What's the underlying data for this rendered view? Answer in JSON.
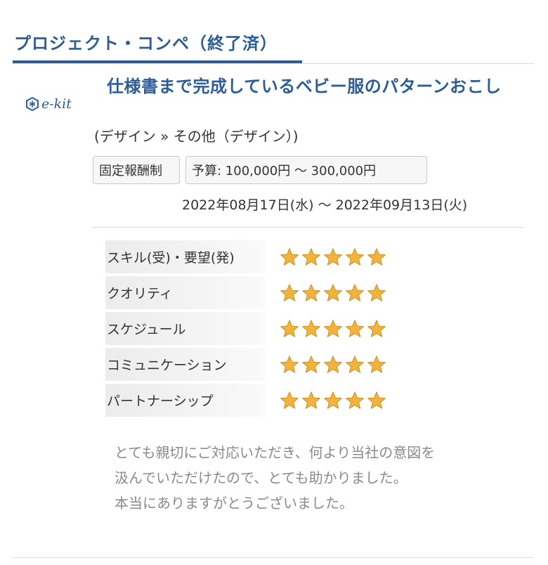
{
  "section": {
    "title": "プロジェクト・コンペ（終了済）",
    "accent_color": "#2e5d96"
  },
  "project": {
    "logo_text": "e-kit",
    "title": "仕様書まで完成しているベビー服のパターンおこし",
    "category": "(デザイン » その他（デザイン）)",
    "fee_type": "固定報酬制",
    "budget": "予算: 100,000円 〜 300,000円",
    "period": "2022年08月17日(水) 〜 2022年09月13日(火)"
  },
  "ratings": [
    {
      "label": "スキル(受)・要望(発)",
      "stars": 5,
      "max": 5
    },
    {
      "label": "クオリティ",
      "stars": 5,
      "max": 5
    },
    {
      "label": "スケジュール",
      "stars": 5,
      "max": 5
    },
    {
      "label": "コミュニケーション",
      "stars": 5,
      "max": 5
    },
    {
      "label": "パートナーシップ",
      "stars": 5,
      "max": 5
    }
  ],
  "comment": {
    "lines": [
      "とても親切にご対応いただき、何より当社の意図を",
      "汲んでいただけたので、とても助かりました。",
      "本当にありますがとうございました。"
    ]
  },
  "icons": {
    "star": "star-icon",
    "logo": "hexagon-logo-icon"
  },
  "colors": {
    "star_fill": "#f2b33d",
    "star_stroke": "#c98a1c",
    "comment_text": "#8a8a8a"
  }
}
